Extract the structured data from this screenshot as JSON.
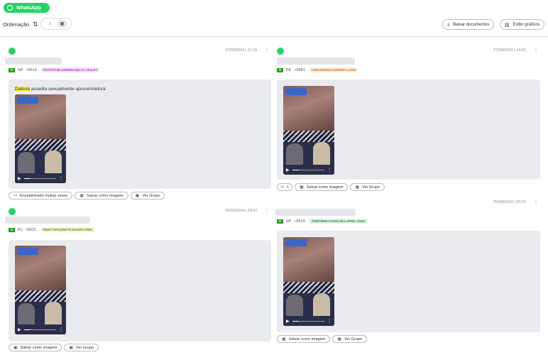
{
  "app": {
    "source_label": "WhatsApp"
  },
  "toolbar": {
    "order_label": "Ordenação",
    "download_label": "Baixar documentos",
    "charts_label": "Exibir gráficos"
  },
  "posts": [
    {
      "date": "27/09/2024 | 11:19",
      "state": "SP",
      "phone": "+5519",
      "tag": "POTATO-BLUEBIRD-DELTA-VIOLET",
      "tag_bg": "#f3e3f7",
      "tag_fg": "#b040b8",
      "caption_highlight": "Datena",
      "caption_rest": " assedia sexualmente apresentadora",
      "forwarded": "Encaminhado muitas vezes",
      "save_label": "Salvar como imagem",
      "group_label": "Ver Grupo"
    },
    {
      "date": "27/09/2024 | 14:01",
      "state": "PE",
      "phone": "+5581",
      "tag": "LION-INDIGO-ROBERT-LAKE",
      "tag_bg": "#fbeedd",
      "tag_fg": "#c07a20",
      "forward_count": "1",
      "save_label": "Salvar como imagem",
      "group_label": "Ver Grupo"
    },
    {
      "date": "25/09/2024 | 10:57",
      "state": "RJ",
      "phone": "+5521",
      "tag": "FRUIT-SPAGHETTI-RUGBY-ITEM",
      "tag_bg": "#eef6d8",
      "tag_fg": "#6a8a10",
      "save_label": "Salvar como imagem",
      "group_label": "Ver Grupo"
    },
    {
      "date": "25/09/2024 | 20:23",
      "state": "SP",
      "phone": "+5519",
      "tag": "THIRTEEN-CAROLINA-APRIL-OHIO",
      "tag_bg": "#dff3e4",
      "tag_fg": "#2a8a4a",
      "save_label": "Salvar como imagem",
      "group_label": "Ver Grupo"
    }
  ]
}
